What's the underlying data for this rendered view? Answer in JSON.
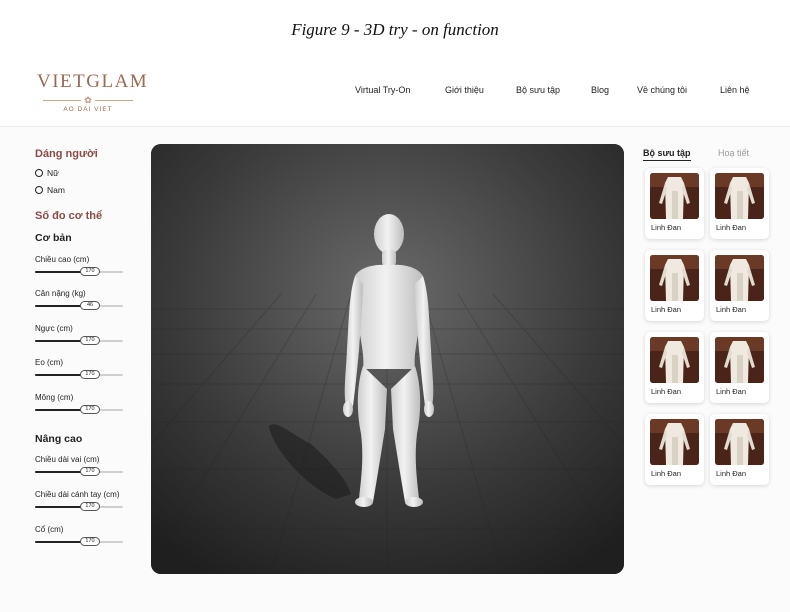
{
  "caption": "Figure 9 - 3D try - on function",
  "brand": {
    "name": "VIETGLAM",
    "tagline": "AO DAI VIET"
  },
  "nav": [
    {
      "label": "Virtual Try-On",
      "active": true
    },
    {
      "label": "Giới thiệu",
      "active": false
    },
    {
      "label": "Bộ sưu tập",
      "active": false
    },
    {
      "label": "Blog",
      "active": false
    },
    {
      "label": "Về chúng tôi",
      "active": false
    },
    {
      "label": "Liên hệ",
      "active": false
    }
  ],
  "sidebar": {
    "body_type_title": "Dáng người",
    "body_types": [
      "Nữ",
      "Nam"
    ],
    "measurements_title": "Số đo cơ thể",
    "basic_title": "Cơ bản",
    "advanced_title": "Nâng cao",
    "basic": [
      {
        "label": "Chiều cao (cm)",
        "value": "170",
        "fraction": 0.62
      },
      {
        "label": "Cân nặng (kg)",
        "value": "46",
        "fraction": 0.62
      },
      {
        "label": "Ngực (cm)",
        "value": "170",
        "fraction": 0.62
      },
      {
        "label": "Eo (cm)",
        "value": "170",
        "fraction": 0.62
      },
      {
        "label": "Mông (cm)",
        "value": "170",
        "fraction": 0.62
      }
    ],
    "advanced": [
      {
        "label": "Chiều dài vai (cm)",
        "value": "170",
        "fraction": 0.62
      },
      {
        "label": "Chiều dài cánh tay (cm)",
        "value": "170",
        "fraction": 0.62
      },
      {
        "label": "Cổ (cm)",
        "value": "170",
        "fraction": 0.62
      }
    ]
  },
  "panel": {
    "tabs": [
      {
        "label": "Bộ sưu tập",
        "active": true
      },
      {
        "label": "Hoạ tiết",
        "active": false
      }
    ],
    "items": [
      "Linh Đan",
      "Linh Đan",
      "Linh Đan",
      "Linh Đan",
      "Linh Đan",
      "Linh Đan",
      "Linh Đan",
      "Linh Đan"
    ]
  },
  "colors": {
    "accent": "#8b4a45",
    "brand": "#9a6a52",
    "viewer_bg": "#333333"
  }
}
